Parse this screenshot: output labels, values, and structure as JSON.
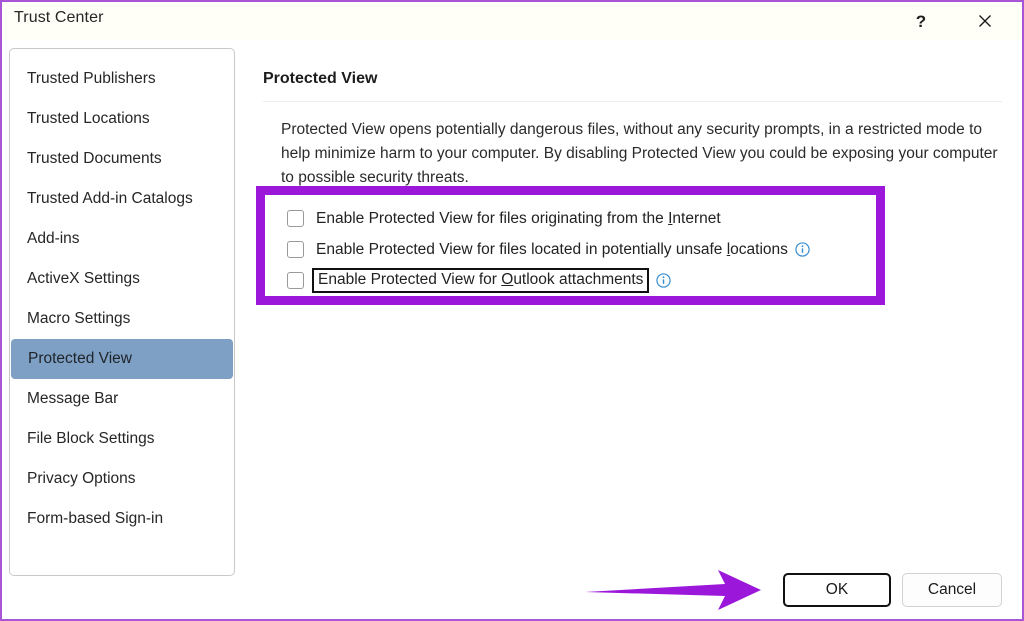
{
  "window": {
    "title": "Trust Center",
    "border_color": "#a855d8"
  },
  "titlebar": {
    "help_icon": "question-mark-help-icon",
    "help_label": "?",
    "close_icon": "close-x-icon",
    "close_label": "✕"
  },
  "sidebar": {
    "items": [
      {
        "label": "Trusted Publishers",
        "selected": false
      },
      {
        "label": "Trusted Locations",
        "selected": false
      },
      {
        "label": "Trusted Documents",
        "selected": false
      },
      {
        "label": "Trusted Add-in Catalogs",
        "selected": false
      },
      {
        "label": "Add-ins",
        "selected": false
      },
      {
        "label": "ActiveX Settings",
        "selected": false
      },
      {
        "label": "Macro Settings",
        "selected": false
      },
      {
        "label": "Protected View",
        "selected": true
      },
      {
        "label": "Message Bar",
        "selected": false
      },
      {
        "label": "File Block Settings",
        "selected": false
      },
      {
        "label": "Privacy Options",
        "selected": false
      },
      {
        "label": "Form-based Sign-in",
        "selected": false
      }
    ],
    "selected_item": "Protected View",
    "selected_color": "#7da0c4"
  },
  "main": {
    "heading": "Protected View",
    "description": "Protected View opens potentially dangerous files, without any security prompts, in a restricted mode to help minimize harm to your computer. By disabling Protected View you could be exposing your computer to possible security threats.",
    "options": [
      {
        "label_before": "Enable Protected View for files originating from the ",
        "accel": "I",
        "label_after": "nternet",
        "checked": false,
        "has_info": false,
        "focused": false
      },
      {
        "label_before": "Enable Protected View for files located in potentially unsafe ",
        "accel": "l",
        "label_after": "ocations",
        "checked": false,
        "has_info": true,
        "focused": false
      },
      {
        "label_before": "Enable Protected View for ",
        "accel": "O",
        "label_after": "utlook attachments",
        "checked": false,
        "has_info": true,
        "focused": true
      }
    ],
    "info_icon": "information-circle-icon",
    "info_icon_color": "#3a8fd0"
  },
  "footer": {
    "ok_label": "OK",
    "cancel_label": "Cancel"
  },
  "annotations": {
    "highlight_box_color": "#9b18db",
    "arrow_color": "#9b18db",
    "arrow_icon": "arrow-right-annotation-icon"
  }
}
